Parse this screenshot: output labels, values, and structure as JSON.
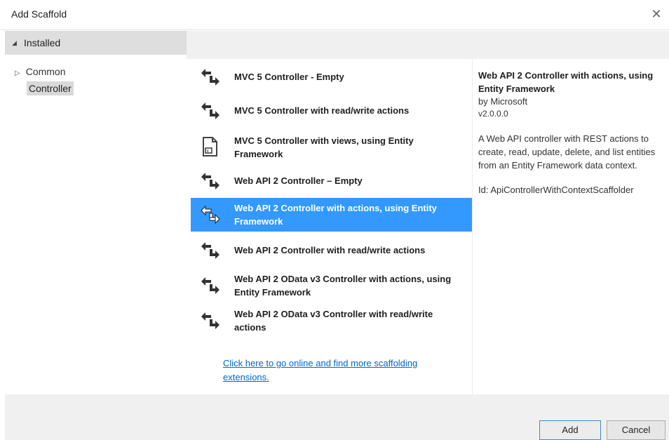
{
  "dialog": {
    "title": "Add Scaffold",
    "close_glyph": "✕"
  },
  "tree": {
    "installed_label": "Installed",
    "installed_caret": "◢",
    "common_caret": "▷",
    "common_label": "Common",
    "controller_label": "Controller"
  },
  "templates": [
    {
      "label": "MVC 5 Controller - Empty",
      "icon": "controller-icon"
    },
    {
      "label": "MVC 5 Controller with read/write actions",
      "icon": "controller-icon"
    },
    {
      "label": "MVC 5 Controller with views, using Entity Framework",
      "icon": "document-view-icon"
    },
    {
      "label": "Web API 2 Controller – Empty",
      "icon": "controller-icon"
    },
    {
      "label": "Web API 2 Controller with actions, using Entity Framework",
      "icon": "controller-icon",
      "selected": true
    },
    {
      "label": "Web API 2 Controller with read/write actions",
      "icon": "controller-icon"
    },
    {
      "label": "Web API 2 OData v3 Controller with actions, using Entity Framework",
      "icon": "controller-icon"
    },
    {
      "label": "Web API 2 OData v3 Controller with read/write actions",
      "icon": "controller-icon"
    }
  ],
  "online_link": "Click here to go online and find more scaffolding extensions.",
  "details": {
    "title": "Web API 2 Controller with actions, using Entity Framework",
    "author": "by Microsoft",
    "version": "v2.0.0.0",
    "description": "A Web API controller with REST actions to create, read, update, delete, and list entities from an Entity Framework data context.",
    "id": "Id: ApiControllerWithContextScaffolder"
  },
  "buttons": {
    "add_label": "Add",
    "cancel_label": "Cancel"
  },
  "colors": {
    "selection": "#3399ff",
    "link": "#0066cc",
    "panel": "#f0f0f0"
  }
}
